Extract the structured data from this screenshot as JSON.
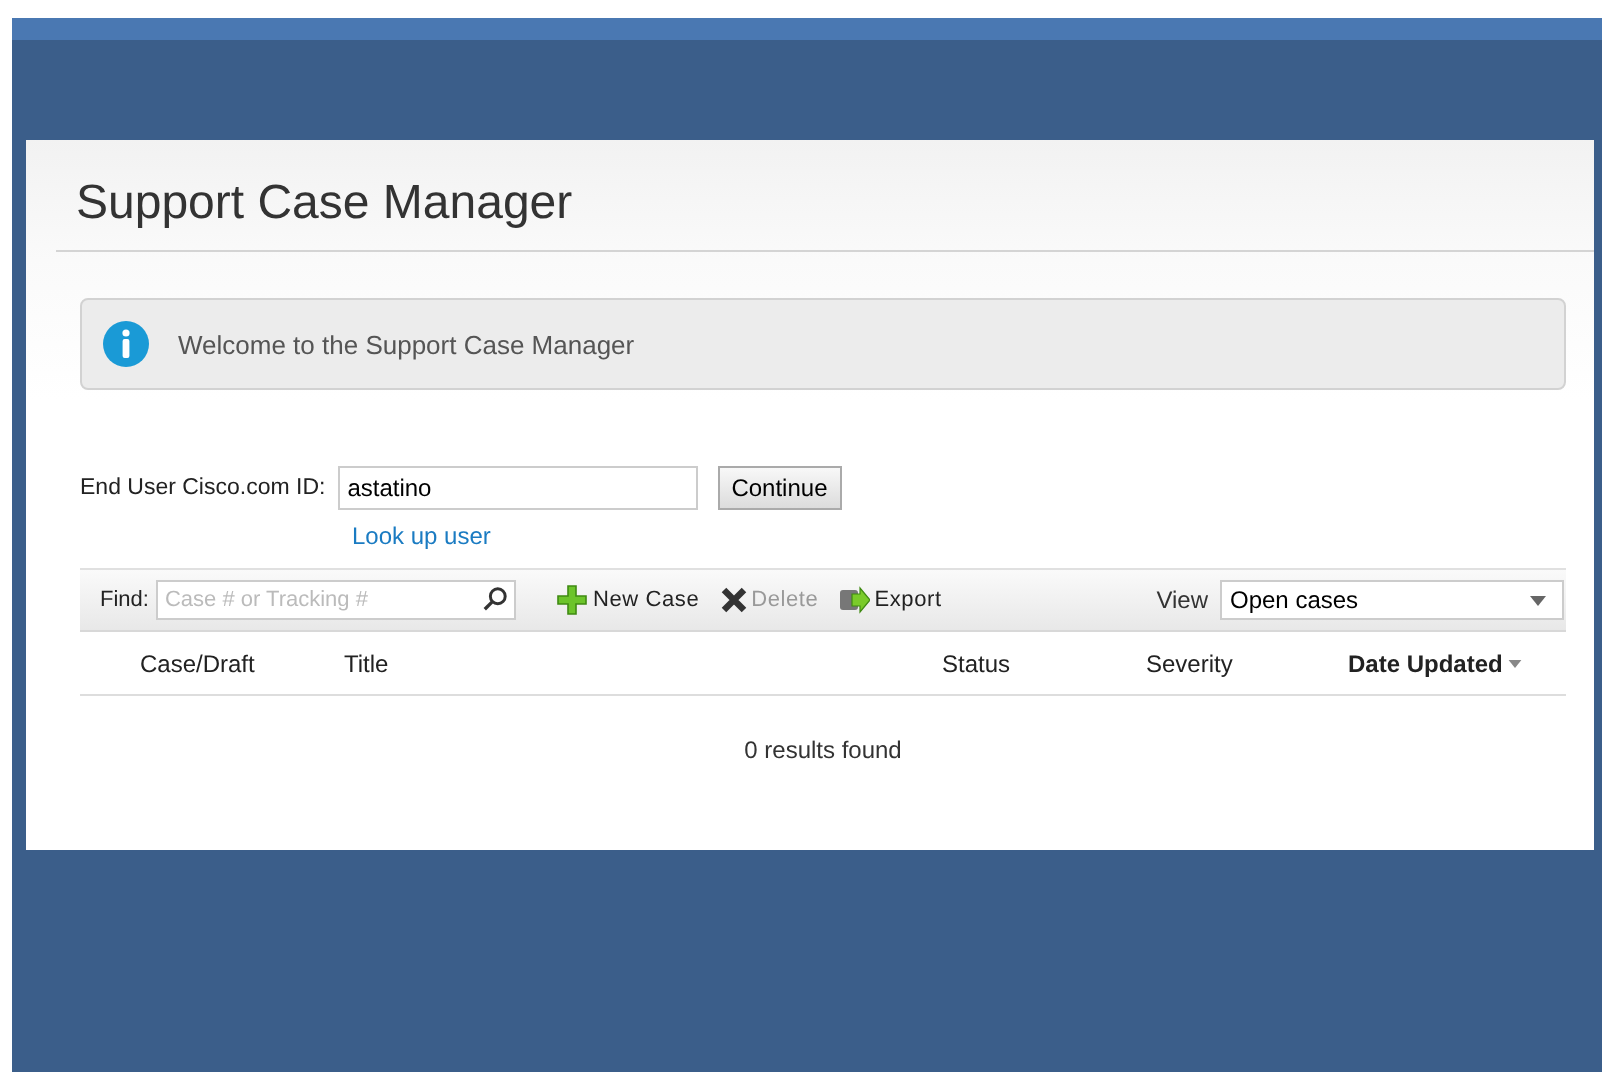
{
  "page": {
    "title": "Support Case Manager"
  },
  "notice": {
    "text": "Welcome to the Support Case Manager"
  },
  "user_lookup": {
    "label": "End User Cisco.com ID:",
    "value": "astatino",
    "button": "Continue",
    "link": "Look up user"
  },
  "toolbar": {
    "find_label": "Find:",
    "find_placeholder": "Case # or Tracking #",
    "actions": [
      {
        "kind": "add",
        "label": "New Case",
        "disabled": false
      },
      {
        "kind": "delete",
        "label": "Delete",
        "disabled": true
      },
      {
        "kind": "export",
        "label": "Export",
        "disabled": false
      }
    ],
    "view_label": "View",
    "view_value": "Open cases"
  },
  "table": {
    "columns": [
      {
        "label": "Case/Draft",
        "sorted": false
      },
      {
        "label": "Title",
        "sorted": false
      },
      {
        "label": "Status",
        "sorted": false
      },
      {
        "label": "Severity",
        "sorted": false
      },
      {
        "label": "Date Updated",
        "sorted": true
      }
    ],
    "empty_message": "0 results found"
  }
}
